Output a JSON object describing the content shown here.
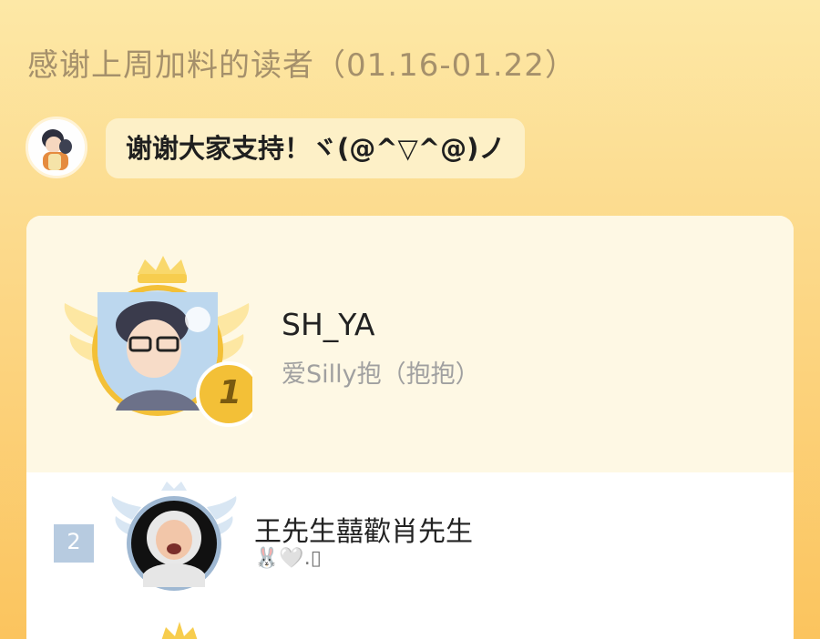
{
  "header": {
    "title": "感谢上周加料的读者（01.16-01.22）"
  },
  "message": {
    "text": "谢谢大家支持！ヾ(@^▽^@)ノ"
  },
  "ranking": {
    "first": {
      "rank": "1",
      "name": "SH_YA",
      "subtitle": "爱Silly抱（抱抱）"
    },
    "second": {
      "rank": "2",
      "name": "王先生囍歡肖先生",
      "subtitle": "🐰🤍.▯"
    }
  },
  "colors": {
    "gold": "#f3c037",
    "silver": "#b7cbe0",
    "title": "#a5906b"
  }
}
